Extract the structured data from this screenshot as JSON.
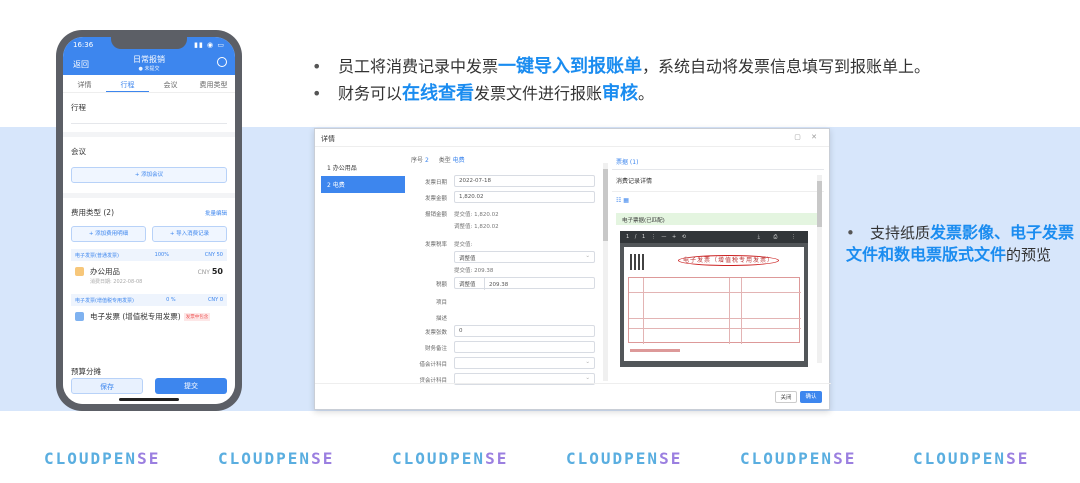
{
  "bullets": {
    "b1": {
      "pre": "员工将消费记录中发票",
      "hl": "一键导入到报账单",
      "post": "，系统自动将发票信息填写到报账单上。"
    },
    "b2": {
      "pre": "财务可以",
      "hl": "在线查看",
      "mid": "发票文件进行报账",
      "hl2": "审核",
      "post": "。"
    },
    "b3": {
      "pre": "支持纸质",
      "hl": "发票影像、电子发票文件和数电票版式文件",
      "post": "的预览"
    }
  },
  "phone": {
    "time": "16:36",
    "back": "返回",
    "title": "日常报销",
    "subtitle": "● 未提交",
    "tabs": [
      "详情",
      "行程",
      "会议",
      "费用类型"
    ],
    "active_tab": "行程",
    "trip_label": "行程",
    "meeting_label": "会议",
    "add_meeting": "+ 添加会议",
    "fee_type": "费用类型 (2)",
    "batch_edit": "批量编辑",
    "add_fee_detail": "+ 添加费用明细",
    "import_record": "+ 导入消费记录",
    "card1_head": "电子发票(普通发票)",
    "card1_pct": "100%",
    "card1_amt": "CNY 50",
    "item1_name": "办公用品",
    "item1_cur": "CNY",
    "item1_amt": "50",
    "item1_date": "消费日期: 2022-08-08",
    "card2_head": "电子发票(增值税专用发票)",
    "card2_pct": "0 %",
    "card2_amt": "CNY 0",
    "item2_name": "电子发票 (增值税专用发票)",
    "item2_tag": "发票中包含",
    "budget": "预算分摊",
    "save": "保存",
    "submit": "提交"
  },
  "modal": {
    "title": "详情",
    "nav": [
      "1  办公用品",
      "2  电费"
    ],
    "active_nav": 1,
    "seq_label": "序号",
    "seq": "2",
    "type_label": "类型",
    "type": "电费",
    "fields": {
      "date_label": "发票日期",
      "date": "2022-07-18",
      "amount_label": "发票金额",
      "amount": "1,820.02",
      "report_label": "报销金额",
      "report_a": "提交值: 1,820.02",
      "report_b": "调整值: 1,820.02",
      "rate_label": "发票税率",
      "rate_a": "提交值:",
      "rate_b": "调整值",
      "tax_label": "税额",
      "tax_a": "提交值: 209.38",
      "tax_b_lbl": "调整值",
      "tax_b": "209.38",
      "project_label": "项目",
      "desc_label": "描述",
      "count_label": "发票张数",
      "count": "0",
      "note_label": "财务备注",
      "debit_label": "借会计科目",
      "credit_label": "贷会计科目"
    },
    "right_tab": "票据 (1)",
    "right_sub": "消费记录详情",
    "green_text": "电子票据(已匹配)",
    "pdf_page": "1 / 1",
    "invoice_title": "电子发票（增值税专用发票）",
    "close": "关闭",
    "ok": "确认"
  },
  "logos": {
    "text": "CLOUDPEN",
    "accent": "SE"
  },
  "colors": {
    "accent": "#1a8cf0",
    "band": "#d7e6fb",
    "logo": "#5aaee0",
    "logo_accent": "#9b7fe0"
  }
}
